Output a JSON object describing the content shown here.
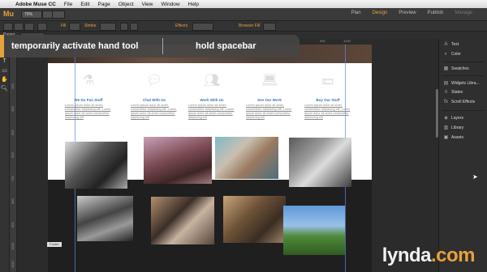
{
  "menubar": {
    "app": "Adobe Muse CC",
    "items": [
      "File",
      "Edit",
      "Page",
      "Object",
      "View",
      "Window",
      "Help"
    ]
  },
  "appbar": {
    "logo": "Mu",
    "zoom": "70%",
    "modes": [
      "Plan",
      "Design",
      "Preview",
      "Publish",
      "Manage"
    ],
    "active_mode": "Design"
  },
  "controlstrip": {
    "fill_label": "Fill",
    "stroke_label": "Stroke",
    "effects_label": "Effects",
    "browser_fill_label": "Browser Fill"
  },
  "pages": {
    "label": "Pages:",
    "value": "No Selection"
  },
  "overlay": {
    "action": "temporarily activate hand tool",
    "shortcut": "hold spacebar"
  },
  "ruler": {
    "h": [
      "900",
      "1000"
    ],
    "v": [
      "300",
      "400",
      "500",
      "600",
      "700",
      "800",
      "900",
      "1000",
      "1100",
      "1200"
    ]
  },
  "columns": [
    {
      "title": "We Do Fun Stuff",
      "body": "Lorem ipsum dolor sit amet, consectetur adipiscing elit. Lorem ipsum dolor sit amet consectetur adipiscing elit"
    },
    {
      "title": "Chat With Us",
      "body": "Lorem ipsum dolor sit amet, consectetur adipiscing elit. Lorem ipsum dolor sit amet consectetur adipiscing elit"
    },
    {
      "title": "Work With Us",
      "body": "Lorem ipsum dolor sit amet, consectetur adipiscing elit. Lorem ipsum dolor sit amet consectetur adipiscing elit"
    },
    {
      "title": "See Our Work",
      "body": "Lorem ipsum dolor sit amet, consectetur adipiscing elit. Lorem ipsum dolor sit amet consectetur adipiscing elit"
    },
    {
      "title": "Buy Our Stuff",
      "body": "Lorem ipsum dolor sit amet, consectetur adipiscing elit. Lorem ipsum dolor sit amet consectetur adipiscing elit"
    }
  ],
  "panel": {
    "items": [
      {
        "icon": "text-icon",
        "label": "Text"
      },
      {
        "icon": "color-icon",
        "label": "Color"
      },
      {
        "icon": "swatches-icon",
        "label": "Swatches"
      },
      {
        "icon": "widgets-icon",
        "label": "Widgets Libra..."
      },
      {
        "icon": "states-icon",
        "label": "States"
      },
      {
        "icon": "scroll-effects-icon",
        "label": "Scroll Effects"
      },
      {
        "icon": "layers-icon",
        "label": "Layers"
      },
      {
        "icon": "library-icon",
        "label": "Library"
      },
      {
        "icon": "assets-icon",
        "label": "Assets"
      }
    ]
  },
  "badge": "Footer",
  "watermark": {
    "name": "lynda",
    "suffix": ".com"
  }
}
